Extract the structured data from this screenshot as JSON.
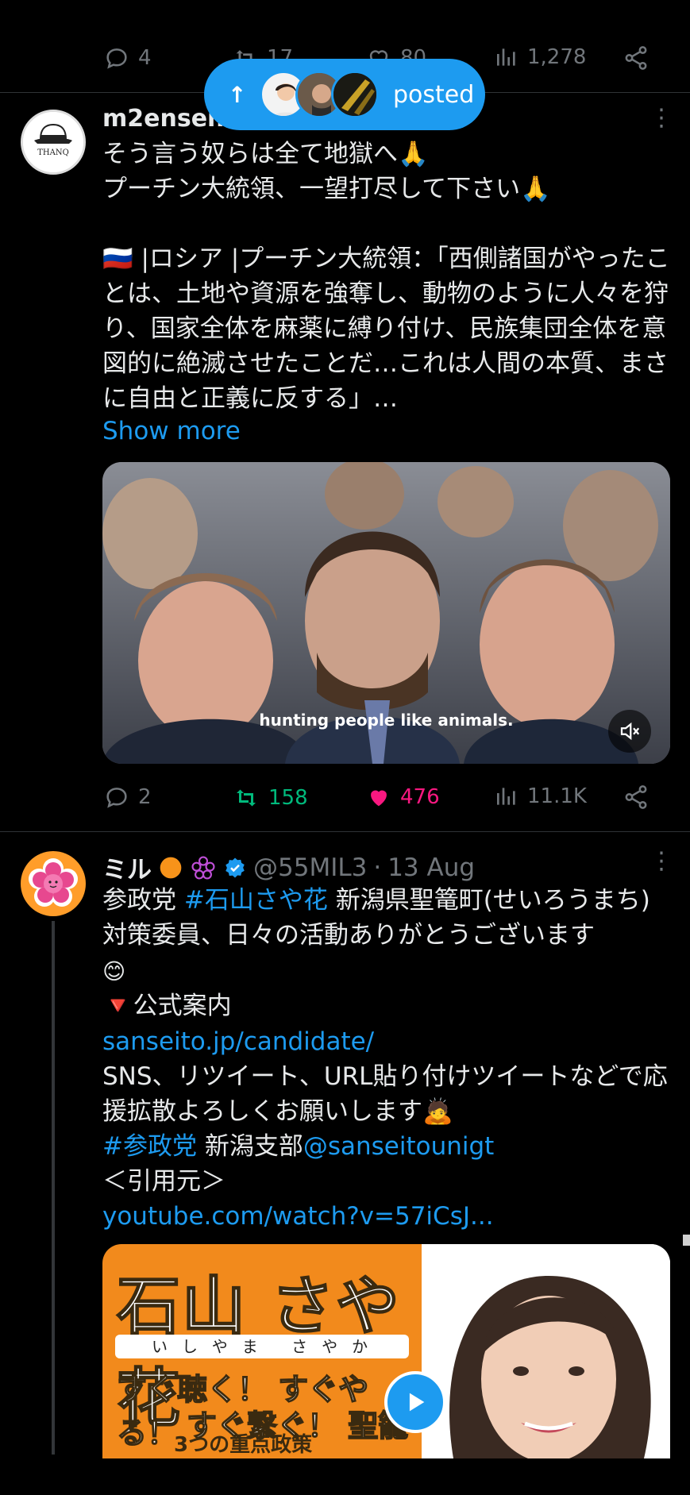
{
  "prev_tweet_actions": {
    "replies": "4",
    "reposts": "17",
    "likes": "80",
    "views": "1,278"
  },
  "posted_pill": {
    "label": "posted"
  },
  "tweet1": {
    "author": "m2ensen",
    "text": "そう言う奴らは全て地獄へ🙏\nプーチン大統領、一望打尽して下さい🙏\n\n🇷🇺 |ロシア |プーチン大統領：「西側諸国がやったことは、土地や資源を強奪し、動物のように人々を狩り、国家全体を麻薬に縛り付け、民族集団全体を意図的に絶滅させたことだ…これは人間の本質、まさに自由と正義に反する」…",
    "show_more": "Show more",
    "video_caption": "hunting people like animals.",
    "replies": "2",
    "reposts": "158",
    "likes": "476",
    "views": "11.1K"
  },
  "tweet2": {
    "name": "ミル",
    "handle": "@55MIL3",
    "date": "13 Aug",
    "line1_prefix": "参政党 ",
    "line1_hashtag": "#石山さや花",
    "line1_rest": " 新潟県聖篭町(せいろうまち)対策委員、日々の活動ありがとうございます",
    "emoji_smile": "😊",
    "official_label": "🔻公式案内",
    "link1": "sanseito.jp/candidate/",
    "text2": "SNS、リツイート、URL貼り付けツイートなどで応援拡散よろしくお願いします🙇",
    "hashtag2": "#参政党",
    "branch": " 新潟支部",
    "mention": "@sanseitounigt",
    "quote_label": "＜引用元＞",
    "link2": "youtube.com/watch?v=57iCsJ...",
    "banner": {
      "title": "石山 さや花",
      "ruby": "いしやま さやか",
      "line2": "すぐ聴く！ すぐやる！",
      "line3": "すぐ繋ぐ！ 聖籠",
      "line4": "3つの重点政策"
    }
  },
  "colors": {
    "accent": "#1d9bf0",
    "repost_green": "#00ba7c",
    "like_pink": "#f91880",
    "muted": "#71767b"
  }
}
